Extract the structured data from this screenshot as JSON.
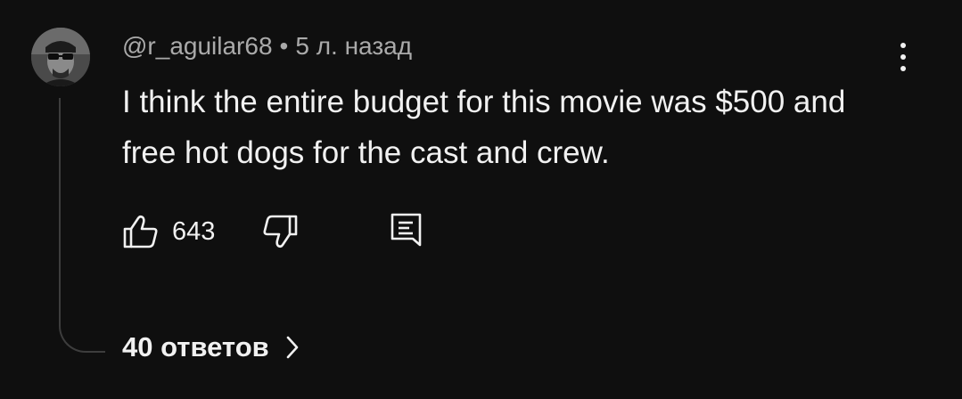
{
  "comment": {
    "username": "@r_aguilar68",
    "separator": "•",
    "timestamp": "5 л. назад",
    "text": "I think the entire budget for this movie was $500 and free hot dogs for the cast and crew.",
    "like_count": "643",
    "replies_label": "40 ответов"
  },
  "icons": {
    "avatar": "avatar-image",
    "menu": "more-vertical-icon",
    "like": "thumb-up-icon",
    "dislike": "thumb-down-icon",
    "reply": "comment-reply-icon",
    "replies": "chevron-right-icon"
  },
  "colors": {
    "background": "#0f0f0f",
    "text": "#f1f1f1",
    "secondary_text": "#aaaaaa",
    "thread_line": "#3d3d3d"
  }
}
